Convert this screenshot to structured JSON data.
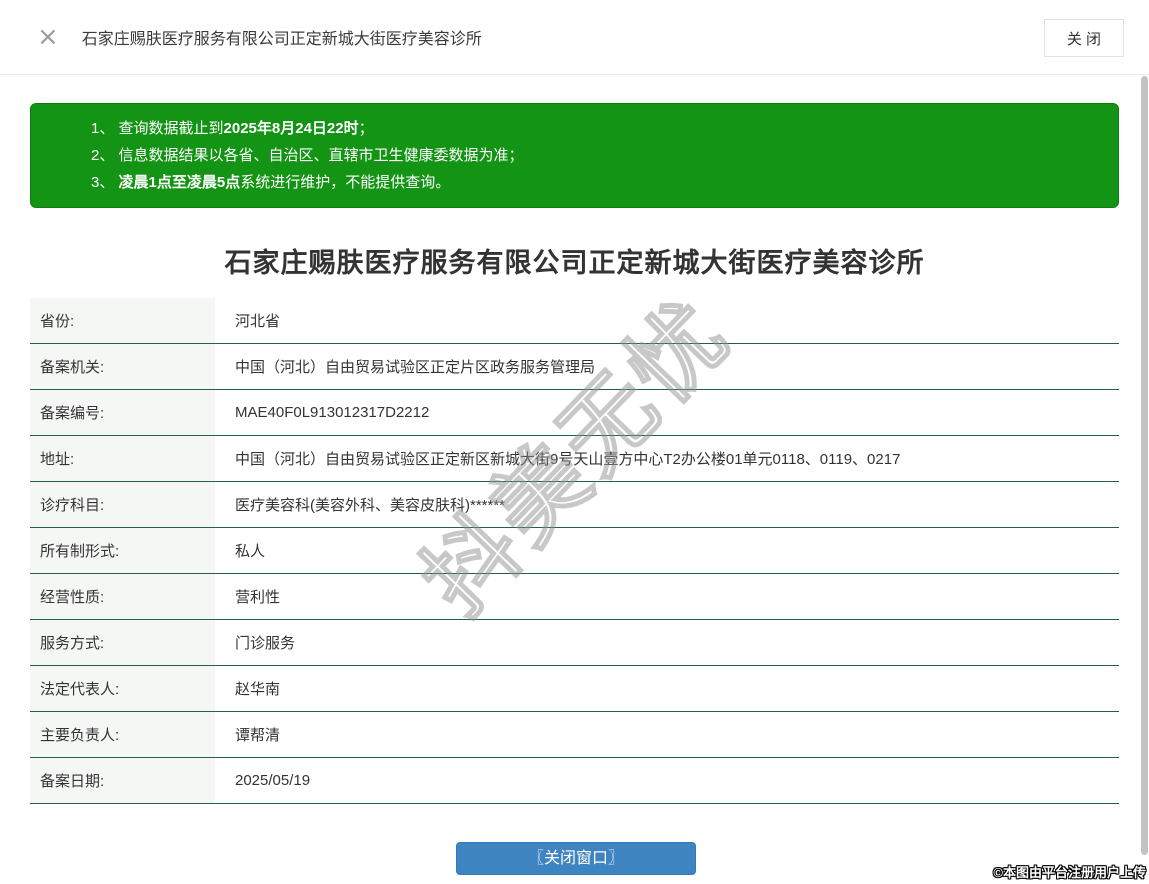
{
  "header": {
    "close_icon": "×",
    "title": "石家庄赐肤医疗服务有限公司正定新城大街医疗美容诊所",
    "close_button": "关 闭"
  },
  "notice": {
    "lines": [
      {
        "before": "1、 查询数据截止到",
        "bold": "2025年8月24日22时",
        "after": "；"
      },
      {
        "before": "2、 信息数据结果以各省、自治区、直辖市卫生健康委数据为准；",
        "bold": "",
        "after": ""
      },
      {
        "before": "3、 ",
        "bold": "凌晨1点至凌晨5点",
        "after": "系统进行维护，不能提供查询。"
      }
    ]
  },
  "detail": {
    "title": "石家庄赐肤医疗服务有限公司正定新城大街医疗美容诊所",
    "rows": [
      {
        "label": "省份:",
        "value": "河北省"
      },
      {
        "label": "备案机关:",
        "value": "中国（河北）自由贸易试验区正定片区政务服务管理局"
      },
      {
        "label": "备案编号:",
        "value": "MAE40F0L913012317D2212"
      },
      {
        "label": "地址:",
        "value": "中国（河北）自由贸易试验区正定新区新城大街9号天山壹方中心T2办公楼01单元0118、0119、0217"
      },
      {
        "label": "诊疗科目:",
        "value": "医疗美容科(美容外科、美容皮肤科)******"
      },
      {
        "label": "所有制形式:",
        "value": "私人"
      },
      {
        "label": "经营性质:",
        "value": "营利性"
      },
      {
        "label": "服务方式:",
        "value": "门诊服务"
      },
      {
        "label": "法定代表人:",
        "value": "赵华南"
      },
      {
        "label": "主要负责人:",
        "value": "谭帮清"
      },
      {
        "label": "备案日期:",
        "value": "2025/05/19"
      }
    ]
  },
  "watermark_text": "抖美无忧",
  "footer": {
    "close_window_button": "〖关闭窗口〗",
    "upload_caption": "©本图由平台注册用户上传"
  },
  "colors": {
    "notice_green": "#149414",
    "table_divider": "#235f4c",
    "label_background": "#f5f7f5",
    "button_blue": "#3e84c0"
  }
}
